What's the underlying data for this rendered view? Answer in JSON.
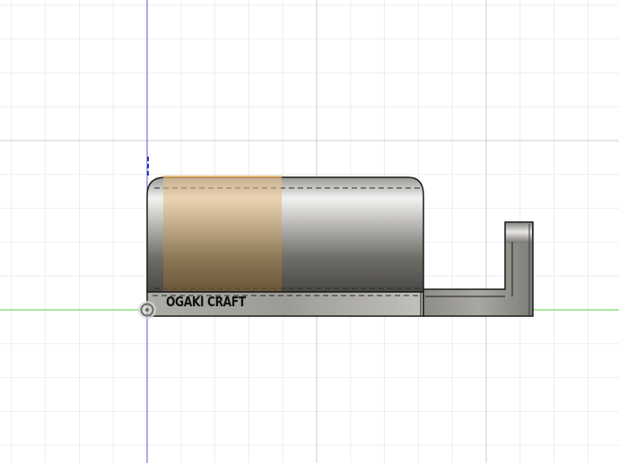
{
  "viewport": {
    "background": "#ffffff",
    "grid_minor_color": "#e8eaee",
    "grid_major_color": "#c9ccd2",
    "x_axis_color": "#7ad86a",
    "y_axis_color": "#5a5ad0"
  },
  "model": {
    "engraving_text": "OGAKI CRAFT",
    "body_color": "#8c8a84",
    "highlight_color": "#c9a060",
    "edge_color": "#1a1a1a"
  },
  "icons": {
    "origin": "origin-point-icon"
  }
}
